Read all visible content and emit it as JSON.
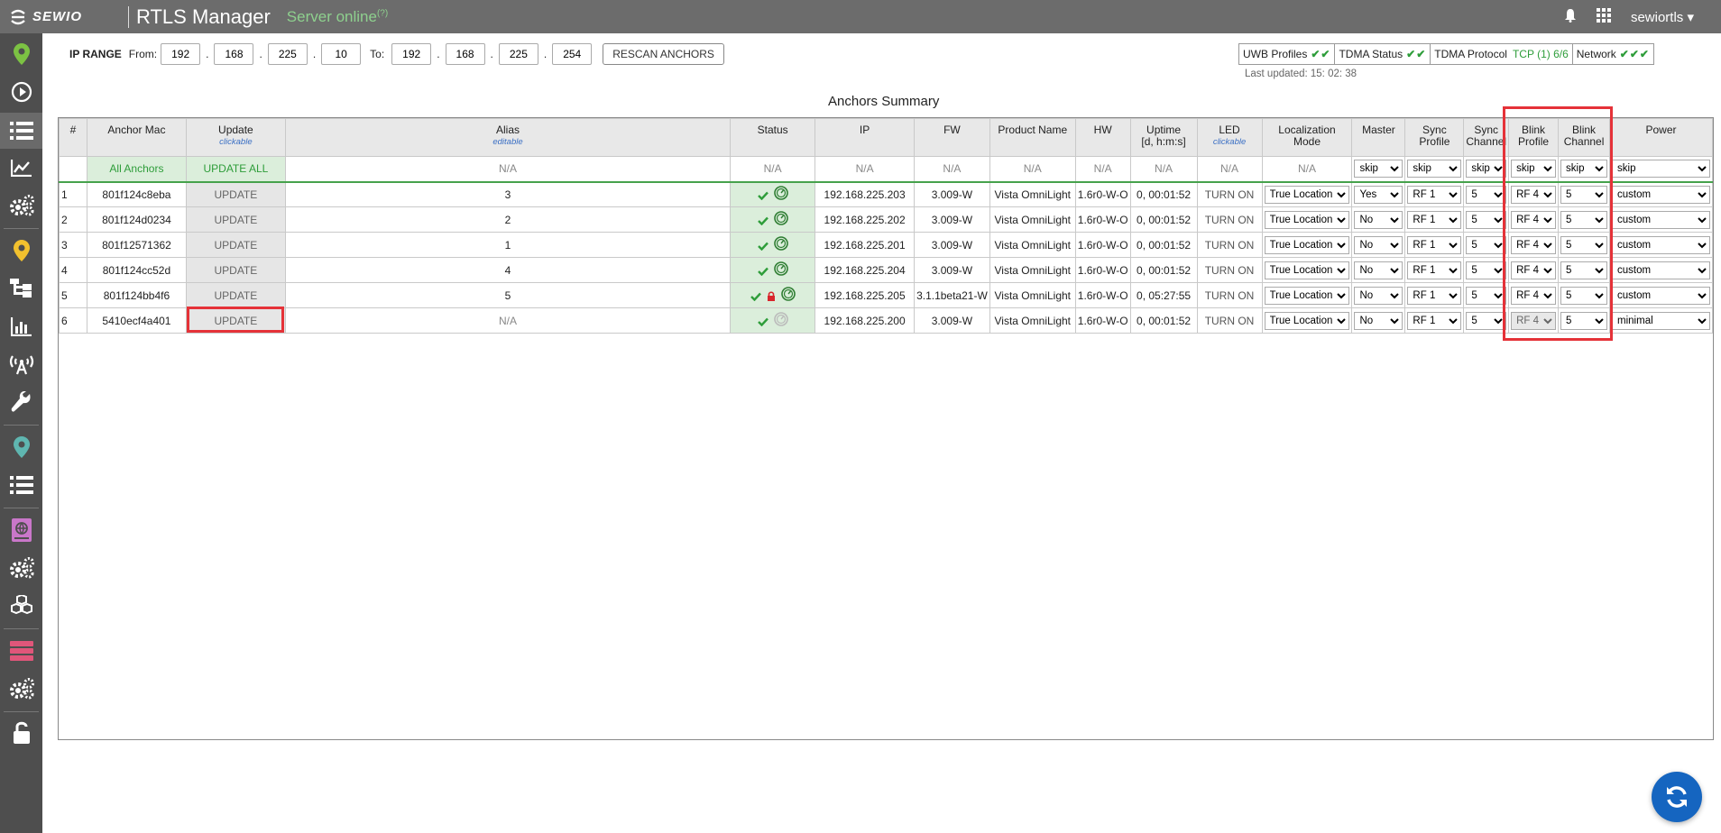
{
  "header": {
    "logo_text": "SEWIO",
    "app_title": "RTLS Manager",
    "server_status": "Server online",
    "server_status_sup": "(?)",
    "user": "sewiortls"
  },
  "sidebar": {
    "items": [
      "location-pin-icon",
      "play-icon",
      "list-icon",
      "chart-line-icon",
      "gears-icon",
      "map-pin-icon",
      "hierarchy-icon",
      "bar-chart-icon",
      "antenna-icon",
      "wrench-icon",
      "map-marker-icon",
      "list-icon",
      "book-globe-icon",
      "gears-icon",
      "cubes-icon",
      "server-icon",
      "gears-icon",
      "unlock-icon"
    ]
  },
  "ip_range": {
    "label": "IP RANGE",
    "from_label": "From:",
    "to_label": "To:",
    "from": [
      "192",
      "168",
      "225",
      "10"
    ],
    "to": [
      "192",
      "168",
      "225",
      "254"
    ],
    "rescan_label": "RESCAN ANCHORS"
  },
  "status_boxes": [
    {
      "label": "UWB Profiles",
      "ok": "✔✔"
    },
    {
      "label": "TDMA Status",
      "ok": "✔✔"
    },
    {
      "label": "TDMA Protocol",
      "ok": "",
      "extra": "TCP (1) 6/6"
    },
    {
      "label": "Network",
      "ok": "✔✔✔"
    }
  ],
  "last_updated": "Last updated: 15: 02: 38",
  "summary_title": "Anchors Summary",
  "table": {
    "headers": {
      "num": "#",
      "mac": "Anchor Mac",
      "update": "Update",
      "update_sub": "clickable",
      "alias": "Alias",
      "alias_sub": "editable",
      "status": "Status",
      "ip": "IP",
      "fw": "FW",
      "product": "Product Name",
      "hw": "HW",
      "uptime": "Uptime",
      "uptime_sub": "[d, h:m:s]",
      "led": "LED",
      "led_sub": "clickable",
      "locmode": "Localization",
      "locmode2": "Mode",
      "master": "Master",
      "syncprof": "Sync",
      "syncprof2": "Profile",
      "syncch": "Sync",
      "syncch2": "Channel",
      "blinkprof": "Blink",
      "blinkprof2": "Profile",
      "blinkch": "Blink",
      "blinkch2": "Channel",
      "power": "Power"
    },
    "all_row": {
      "mac": "All Anchors",
      "update": "UPDATE ALL",
      "na": "N/A",
      "skip": "skip"
    },
    "rows": [
      {
        "num": "1",
        "mac": "801f124c8eba",
        "update": "UPDATE",
        "alias": "3",
        "ip": "192.168.225.203",
        "fw": "3.009-W",
        "product": "Vista OmniLight",
        "hw": "1.6r0-W-O",
        "uptime": "0, 00:01:52",
        "led": "TURN ON",
        "locmode": "True Location",
        "master": "Yes",
        "syncprof": "RF 1",
        "syncch": "5",
        "blinkprof": "RF 4",
        "blinkch": "5",
        "power": "custom"
      },
      {
        "num": "2",
        "mac": "801f124d0234",
        "update": "UPDATE",
        "alias": "2",
        "ip": "192.168.225.202",
        "fw": "3.009-W",
        "product": "Vista OmniLight",
        "hw": "1.6r0-W-O",
        "uptime": "0, 00:01:52",
        "led": "TURN ON",
        "locmode": "True Location",
        "master": "No",
        "syncprof": "RF 1",
        "syncch": "5",
        "blinkprof": "RF 4",
        "blinkch": "5",
        "power": "custom"
      },
      {
        "num": "3",
        "mac": "801f12571362",
        "update": "UPDATE",
        "alias": "1",
        "ip": "192.168.225.201",
        "fw": "3.009-W",
        "product": "Vista OmniLight",
        "hw": "1.6r0-W-O",
        "uptime": "0, 00:01:52",
        "led": "TURN ON",
        "locmode": "True Location",
        "master": "No",
        "syncprof": "RF 1",
        "syncch": "5",
        "blinkprof": "RF 4",
        "blinkch": "5",
        "power": "custom"
      },
      {
        "num": "4",
        "mac": "801f124cc52d",
        "update": "UPDATE",
        "alias": "4",
        "ip": "192.168.225.204",
        "fw": "3.009-W",
        "product": "Vista OmniLight",
        "hw": "1.6r0-W-O",
        "uptime": "0, 00:01:52",
        "led": "TURN ON",
        "locmode": "True Location",
        "master": "No",
        "syncprof": "RF 1",
        "syncch": "5",
        "blinkprof": "RF 4",
        "blinkch": "5",
        "power": "custom"
      },
      {
        "num": "5",
        "mac": "801f124bb4f6",
        "update": "UPDATE",
        "alias": "5",
        "ip": "192.168.225.205",
        "fw": "3.1.1beta21-W",
        "product": "Vista OmniLight",
        "hw": "1.6r0-W-O",
        "uptime": "0, 05:27:55",
        "led": "TURN ON",
        "locmode": "True Location",
        "master": "No",
        "syncprof": "RF 1",
        "syncch": "5",
        "blinkprof": "RF 4",
        "blinkch": "5",
        "power": "custom"
      },
      {
        "num": "6",
        "mac": "5410ecf4a401",
        "update": "UPDATE",
        "alias": "N/A",
        "ip": "192.168.225.200",
        "fw": "3.009-W",
        "product": "Vista OmniLight",
        "hw": "1.6r0-W-O",
        "uptime": "0, 00:01:52",
        "led": "TURN ON",
        "locmode": "True Location",
        "master": "No",
        "syncprof": "RF 1",
        "syncch": "5",
        "blinkprof": "RF 4",
        "blinkch": "5",
        "power": "minimal"
      }
    ]
  },
  "colors": {
    "ok_green": "#2e9d3a",
    "highlight_red": "#e53238",
    "fab_blue": "#1565c0"
  }
}
